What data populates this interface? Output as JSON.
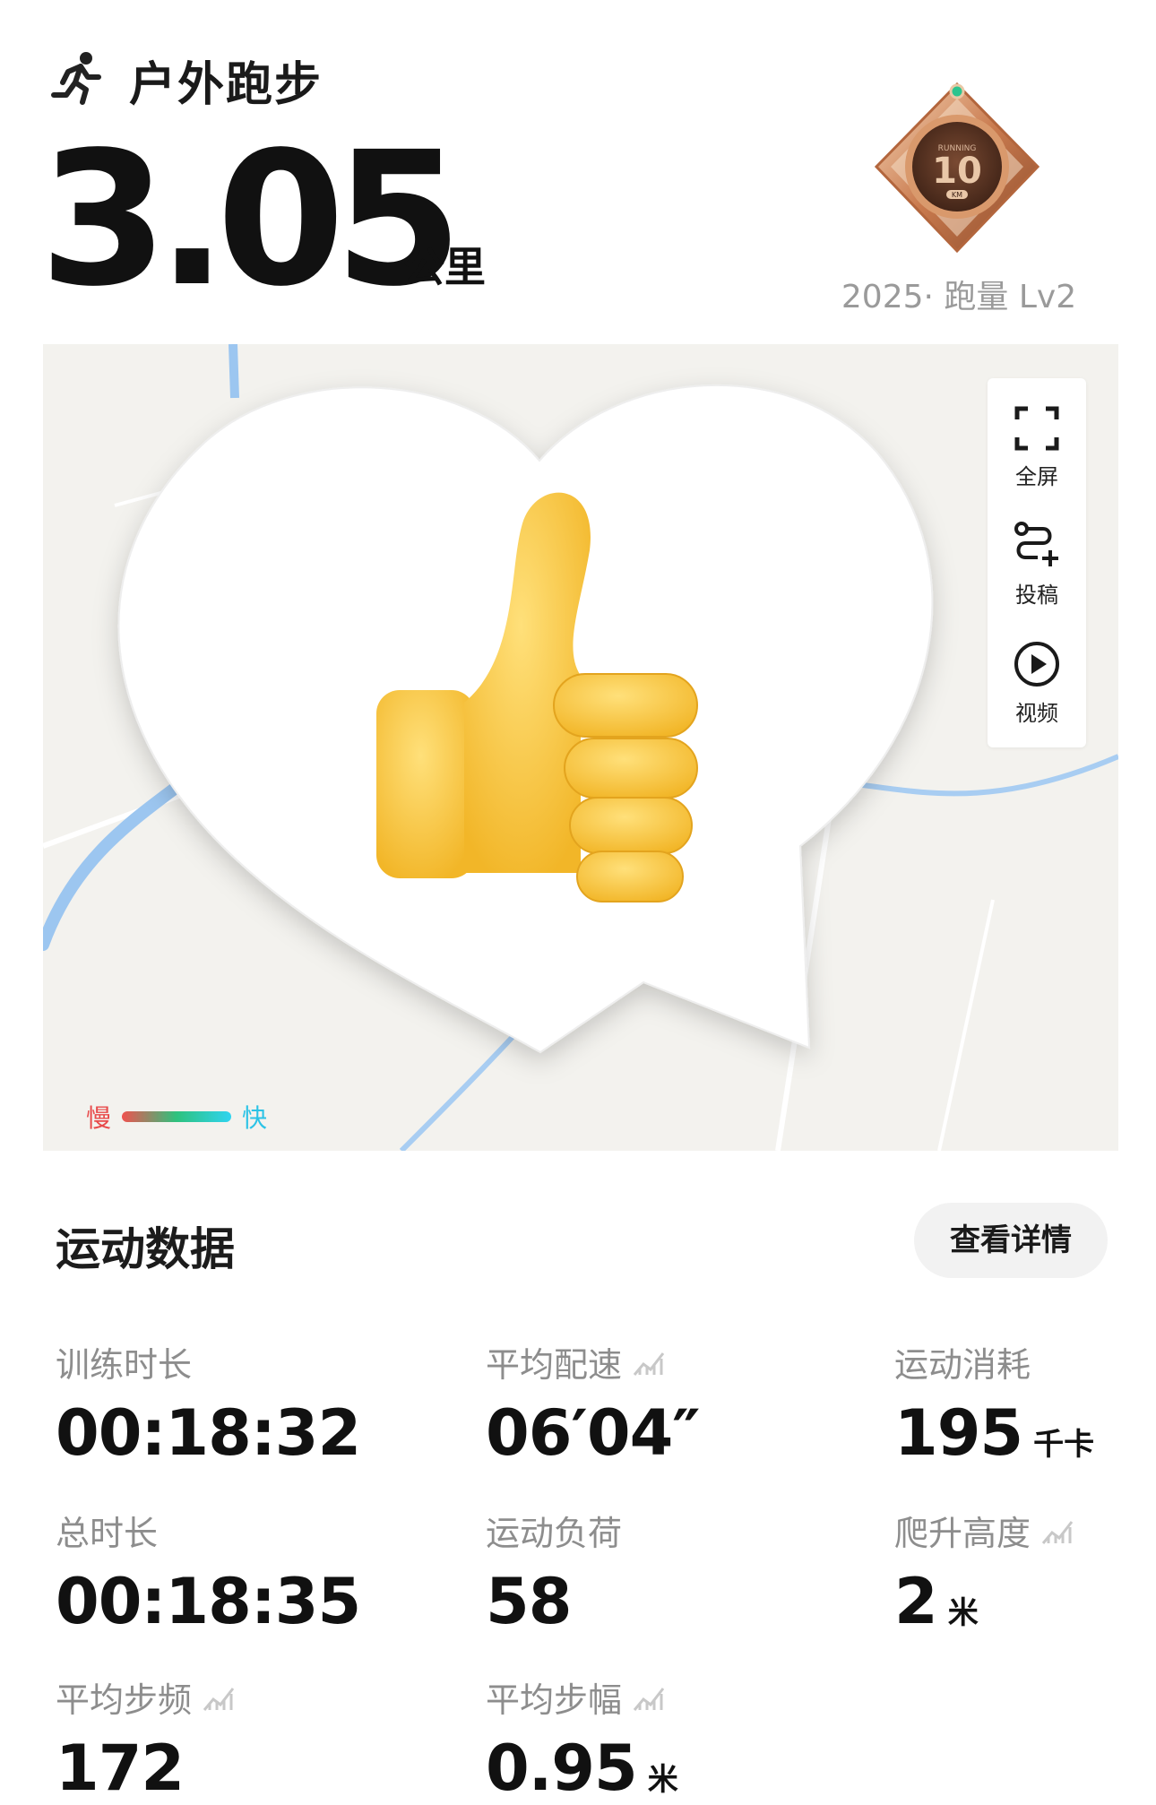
{
  "header": {
    "title": "户外跑步",
    "distance": "3.05",
    "distance_unit": "公里"
  },
  "medal": {
    "label": "2025· 跑量 Lv2",
    "top_text": "RUNNING",
    "number": "10",
    "unit": "KM"
  },
  "map": {
    "tools": [
      {
        "icon": "fullscreen-icon",
        "label": "全屏"
      },
      {
        "icon": "route-add-icon",
        "label": "投稿"
      },
      {
        "icon": "play-circle-icon",
        "label": "视频"
      }
    ],
    "legend": {
      "slow": "慢",
      "fast": "快"
    },
    "overlay": "thumbs-up-heart-sticker"
  },
  "stats": {
    "title": "运动数据",
    "details_button": "查看详情",
    "items": [
      {
        "label": "训练时长",
        "value": "00:18:32",
        "unit": "",
        "chart": false
      },
      {
        "label": "平均配速",
        "value": "06′04″",
        "unit": "",
        "chart": true
      },
      {
        "label": "运动消耗",
        "value": "195",
        "unit": "千卡",
        "chart": false
      },
      {
        "label": "总时长",
        "value": "00:18:35",
        "unit": "",
        "chart": false
      },
      {
        "label": "运动负荷",
        "value": "58",
        "unit": "",
        "chart": false
      },
      {
        "label": "爬升高度",
        "value": "2",
        "unit": "米",
        "chart": true
      },
      {
        "label": "平均步频",
        "value": "172",
        "unit": "",
        "chart": true
      },
      {
        "label": "平均步幅",
        "value": "0.95",
        "unit": "米",
        "chart": true
      }
    ]
  },
  "colors": {
    "slow": "#e84a4a",
    "fast": "#2cc3e6",
    "map_bg": "#f3f2ee",
    "water": "#9cc6f0"
  }
}
